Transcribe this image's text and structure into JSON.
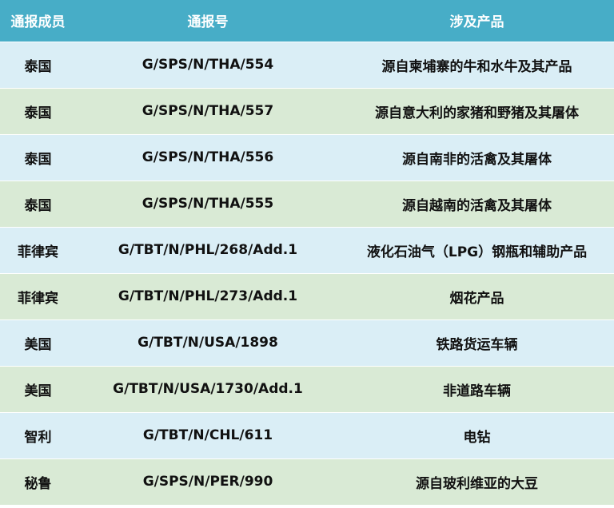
{
  "colors": {
    "header_bg": "#47adc7",
    "row_blue": "#daeef6",
    "row_green": "#d9ead5"
  },
  "headers": [
    "通报成员",
    "通报号",
    "涉及产品"
  ],
  "rows": [
    {
      "member": "泰国",
      "number": "G/SPS/N/THA/554",
      "product": "源自柬埔寨的牛和水牛及其产品"
    },
    {
      "member": "泰国",
      "number": "G/SPS/N/THA/557",
      "product": "源自意大利的家猪和野猪及其屠体"
    },
    {
      "member": "泰国",
      "number": "G/SPS/N/THA/556",
      "product": "源自南非的活禽及其屠体"
    },
    {
      "member": "泰国",
      "number": "G/SPS/N/THA/555",
      "product": "源自越南的活禽及其屠体"
    },
    {
      "member": "菲律宾",
      "number": "G/TBT/N/PHL/268/Add.1",
      "product": "液化石油气（LPG）钢瓶和辅助产品"
    },
    {
      "member": "菲律宾",
      "number": "G/TBT/N/PHL/273/Add.1",
      "product": "烟花产品"
    },
    {
      "member": "美国",
      "number": "G/TBT/N/USA/1898",
      "product": "铁路货运车辆"
    },
    {
      "member": "美国",
      "number": "G/TBT/N/USA/1730/Add.1",
      "product": "非道路车辆"
    },
    {
      "member": "智利",
      "number": "G/TBT/N/CHL/611",
      "product": "电钻"
    },
    {
      "member": "秘鲁",
      "number": "G/SPS/N/PER/990",
      "product": "源自玻利维亚的大豆"
    }
  ]
}
